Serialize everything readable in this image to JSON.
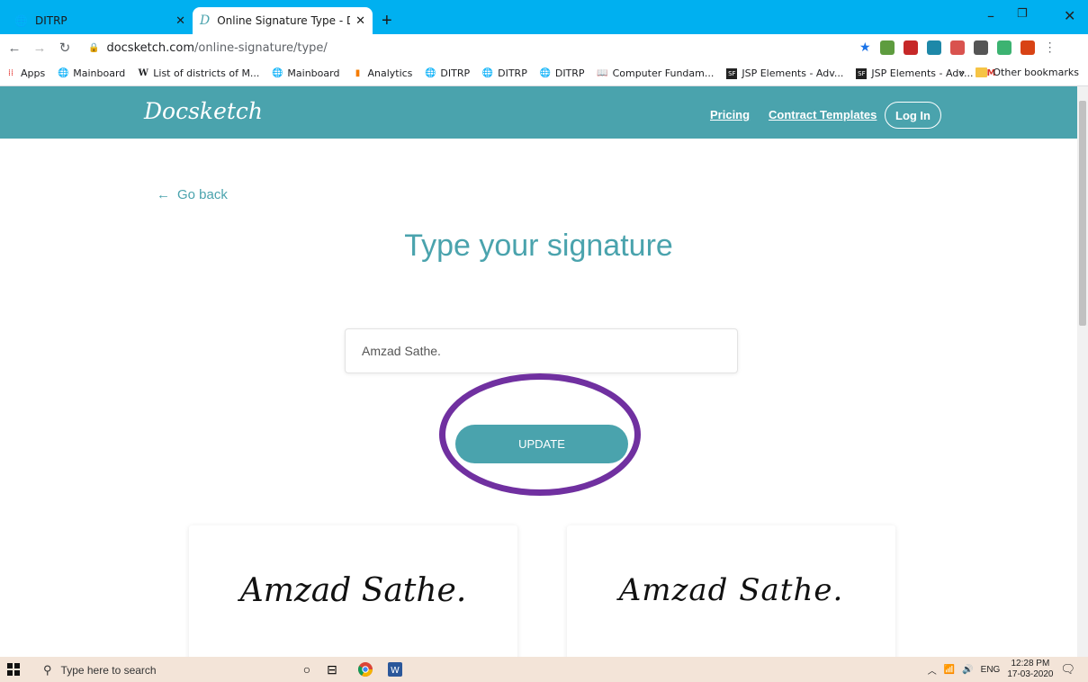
{
  "browser": {
    "tabs": [
      {
        "title": "DITRP",
        "active": false
      },
      {
        "title": "Online Signature Type - Docsketc",
        "active": true
      }
    ],
    "new_tab_symbol": "+",
    "url_domain": "docsketch.com",
    "url_path": "/online-signature/type/",
    "bookmarks": [
      {
        "label": "Apps",
        "icon": "apps-grid-icon"
      },
      {
        "label": "Mainboard",
        "icon": "globe-icon"
      },
      {
        "label": "List of districts of M...",
        "icon": "wikipedia-icon"
      },
      {
        "label": "Mainboard",
        "icon": "globe-icon"
      },
      {
        "label": "Analytics",
        "icon": "analytics-icon"
      },
      {
        "label": "DITRP",
        "icon": "globe-icon"
      },
      {
        "label": "DITRP",
        "icon": "globe-icon"
      },
      {
        "label": "DITRP",
        "icon": "globe-icon"
      },
      {
        "label": "Computer Fundam...",
        "icon": "book-icon"
      },
      {
        "label": "JSP Elements - Adv...",
        "icon": "sf-icon"
      },
      {
        "label": "JSP Elements - Adv...",
        "icon": "sf-icon"
      }
    ],
    "other_bookmarks": "Other bookmarks",
    "overflow": "»"
  },
  "site": {
    "logo": "Docsketch",
    "nav": {
      "pricing": "Pricing",
      "contract_templates": "Contract Templates",
      "login": "Log In"
    },
    "go_back": "Go back",
    "heading": "Type your signature",
    "signature_input_value": "Amzad Sathe.",
    "update_button": "UPDATE",
    "signature_previews": [
      "Amzad Sathe.",
      "Amzad Sathe."
    ]
  },
  "taskbar": {
    "search_placeholder": "Type here to search",
    "language": "ENG",
    "time": "12:28 PM",
    "date": "17-03-2020"
  },
  "colors": {
    "brand_teal": "#4aa3ad",
    "highlight_ring": "#7030a0",
    "desktop_blue": "#00b0f0"
  }
}
